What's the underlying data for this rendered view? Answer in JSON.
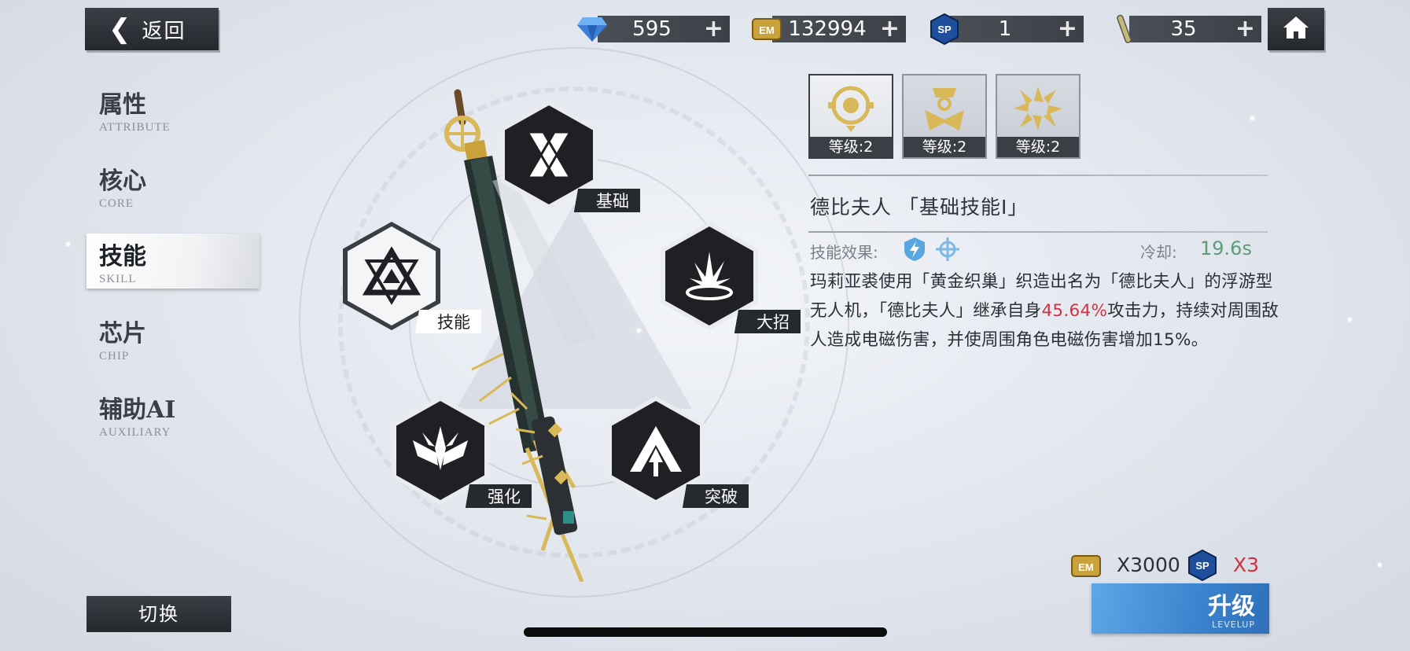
{
  "header": {
    "back_label": "返回",
    "currencies": [
      {
        "name": "crystal",
        "icon": "diamond-icon",
        "value": "595",
        "plus": "+"
      },
      {
        "name": "em",
        "icon": "em-coin-icon",
        "icon_text": "EM",
        "value": "132994",
        "plus": "+"
      },
      {
        "name": "sp",
        "icon": "sp-badge-icon",
        "icon_text": "SP",
        "value": "1",
        "plus": "+"
      },
      {
        "name": "stamina",
        "icon": "stick-icon",
        "value": "35",
        "plus": "+"
      }
    ],
    "home_icon": "home-icon"
  },
  "sidebar": {
    "items": [
      {
        "cn": "属性",
        "en": "ATTRIBUTE",
        "active": false
      },
      {
        "cn": "核心",
        "en": "CORE",
        "active": false
      },
      {
        "cn": "技能",
        "en": "SKILL",
        "active": true
      },
      {
        "cn": "芯片",
        "en": "CHIP",
        "active": false
      },
      {
        "cn": "辅助AI",
        "en": "AUXILIARY",
        "active": false
      }
    ],
    "switch_label": "切换"
  },
  "skill_nodes": [
    {
      "label": "基础",
      "icon": "x-cross-icon",
      "selected": false
    },
    {
      "label": "技能",
      "icon": "triangle-star-icon",
      "selected": true
    },
    {
      "label": "大招",
      "icon": "burst-icon",
      "selected": false
    },
    {
      "label": "强化",
      "icon": "crown-wings-icon",
      "selected": false
    },
    {
      "label": "突破",
      "icon": "arrow-up-icon",
      "selected": false
    }
  ],
  "detail": {
    "tabs": [
      {
        "level": "等级:2",
        "icon": "drone-eye-icon",
        "active": true
      },
      {
        "level": "等级:2",
        "icon": "emblem-icon",
        "active": false
      },
      {
        "level": "等级:2",
        "icon": "pinwheel-icon",
        "active": false
      }
    ],
    "title": "德比夫人 「基础技能Ⅰ」",
    "effect_label": "技能效果:",
    "effect_icons": [
      "lightning-shield-icon",
      "crosshair-icon"
    ],
    "cooldown_label": "冷却:",
    "cooldown_value": "19.6s",
    "desc_part1": "玛莉亚裘使用「黄金织巢」织造出名为「德比夫人」的浮游型无人机，「德比夫人」继承自身",
    "desc_highlight": "45.64%",
    "desc_part2": "攻击力，持续对周围敌人造成电磁伤害，并使周围角色电磁伤害增加15%。"
  },
  "cost": {
    "em_icon_text": "EM",
    "em_amount": "X3000",
    "sp_icon_text": "SP",
    "sp_amount": "X3"
  },
  "upgrade": {
    "cn": "升级",
    "en": "LEVELUP"
  },
  "colors": {
    "accent_blue": "#3b83cd",
    "highlight_red": "#d4313e",
    "cooldown_green": "#5e9b78",
    "dark_panel": "#2a2d32"
  }
}
